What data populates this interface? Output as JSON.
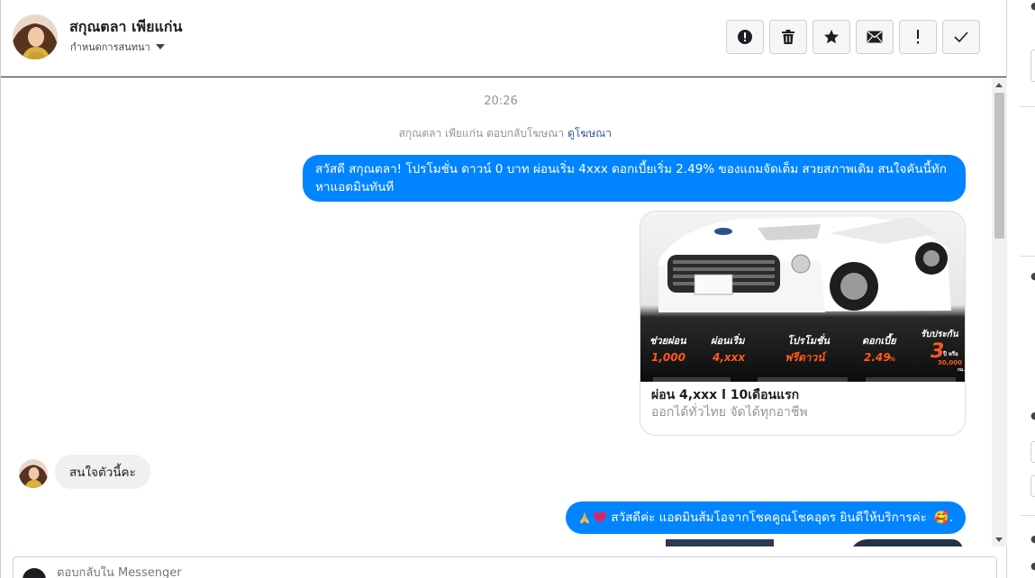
{
  "header": {
    "contact_name": "สกุณตลา เพียแก่น",
    "assign_label": "กำหนดการสนทนา",
    "actions": [
      "mark-spam",
      "delete",
      "star",
      "mark-unread",
      "follow-up",
      "mark-done"
    ]
  },
  "thread": {
    "timestamp": "20:26",
    "ad_reply_note": "สกุณตลา เพียแก่น ตอบกลับโฆษณา",
    "ad_link": "ดูโฆษณา",
    "outgoing_1": "สวัสดี สกุณตลา! โปรโมชั่น ดาวน์ 0 บาท ผ่อนเริ่ม 4xxx ดอกเบี้ยเริ่ม 2.49% ของแถมจัดเต็ม สวยสภาพเดิม สนใจคันนี้ทักหาแอดมินทันที",
    "card": {
      "title": "ผ่อน 4,xxx l 10เดือนแรก",
      "subtitle": "ออกได้ทั่วไทย จัดได้ทุกอาชีพ",
      "image": {
        "labels": [
          "ช่วยผ่อน",
          "ผ่อนเริ่ม",
          "โปรโมชั่น",
          "ดอกเบี้ย",
          "รับประกัน"
        ],
        "values": [
          "1,000",
          "4,xxx",
          "ฟรีดาวน์",
          "2.49",
          "3"
        ],
        "suffix_percent": "%",
        "warranty_unit": "ปี หรือ",
        "warranty_km": "30,000",
        "warranty_km_unit": "กม."
      }
    },
    "incoming_1": "สนใจตัวนี้คะ",
    "outgoing_2": "สวัสดีค่ะ แอดมินส้มโอจากโชคคูณโชคอุดร ยินดีให้บริการค่ะ",
    "outgoing_2_trailer": "🥰."
  },
  "composer": {
    "placeholder": "ตอบกลับใน Messenger"
  },
  "colors": {
    "outgoing_bubble": "#0084ff",
    "incoming_bubble": "#f1f0f0",
    "link": "#385898",
    "muted_text": "#90949c"
  }
}
